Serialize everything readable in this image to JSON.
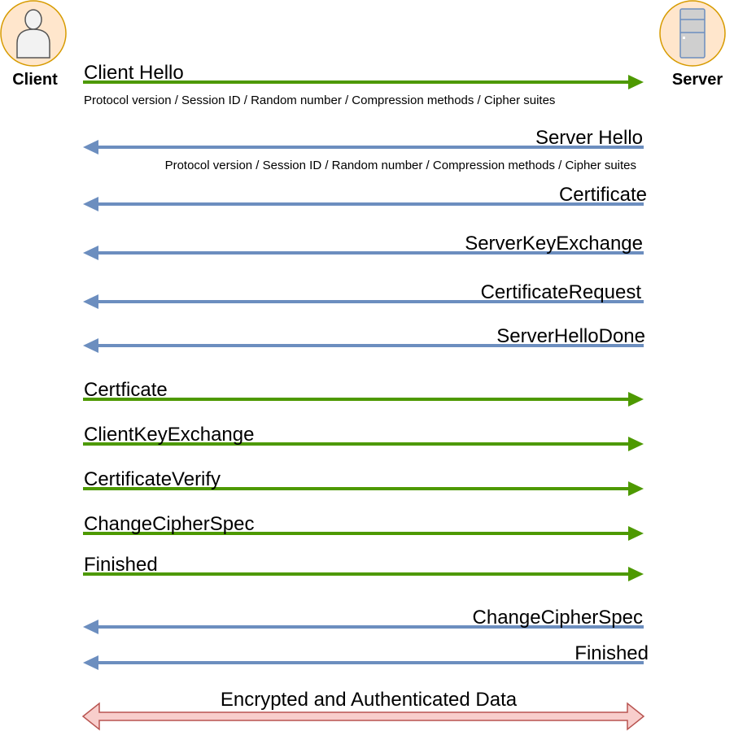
{
  "client": {
    "label": "Client",
    "icon": "user-icon"
  },
  "server": {
    "label": "Server",
    "icon": "server-icon"
  },
  "colors": {
    "green": "#4d9900",
    "blue": "#6c8ebf",
    "actor_fill": "#ffe6cc",
    "actor_stroke": "#d79b00",
    "data_fill": "#f8cecc",
    "data_stroke": "#b85450"
  },
  "messages": [
    {
      "label": "Client Hello",
      "direction": "to-server",
      "detail": "Protocol version / Session ID / Random number / Compression methods / Cipher suites"
    },
    {
      "label": "Server Hello",
      "direction": "to-client",
      "detail": "Protocol version / Session ID / Random number / Compression methods / Cipher suites"
    },
    {
      "label": "Certificate",
      "direction": "to-client"
    },
    {
      "label": "ServerKeyExchange",
      "direction": "to-client"
    },
    {
      "label": "CertificateRequest",
      "direction": "to-client"
    },
    {
      "label": "ServerHelloDone",
      "direction": "to-client"
    },
    {
      "label": "Certficate",
      "direction": "to-server"
    },
    {
      "label": "ClientKeyExchange",
      "direction": "to-server"
    },
    {
      "label": "CertificateVerify",
      "direction": "to-server"
    },
    {
      "label": "ChangeCipherSpec",
      "direction": "to-server"
    },
    {
      "label": "Finished",
      "direction": "to-server"
    },
    {
      "label": "ChangeCipherSpec",
      "direction": "to-client"
    },
    {
      "label": "Finished",
      "direction": "to-client"
    }
  ],
  "data_exchange": {
    "label": "Encrypted and Authenticated Data",
    "direction": "both"
  }
}
